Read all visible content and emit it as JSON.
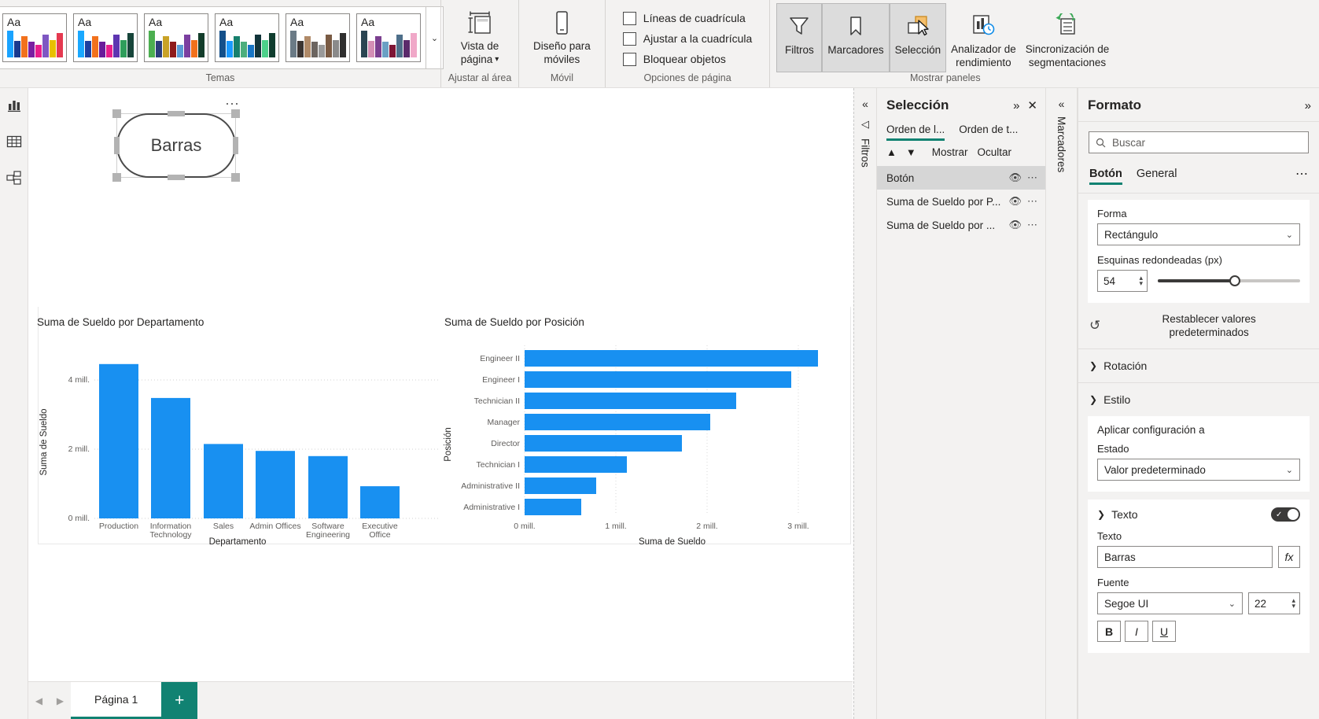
{
  "ribbon": {
    "themes": {
      "group_label": "Temas",
      "card_text": "Aa",
      "cards": [
        {
          "colors": [
            "#1aa3ff",
            "#1a3a8f",
            "#f2711c",
            "#7b1fa2",
            "#e91e8c",
            "#7e57c2",
            "#e8c000",
            "#e53950"
          ]
        },
        {
          "colors": [
            "#19a8ff",
            "#1d3fa0",
            "#f2711c",
            "#6a1b9a",
            "#e91e8c",
            "#5e35b1",
            "#2e9e5b",
            "#17453a"
          ]
        },
        {
          "colors": [
            "#4caf50",
            "#2c3e7a",
            "#c9a227",
            "#8e1b1b",
            "#5b9bd5",
            "#7b3fa0",
            "#f2711c",
            "#133d2b"
          ]
        },
        {
          "colors": [
            "#14508a",
            "#1a9aff",
            "#17806d",
            "#4cae7d",
            "#1775c4",
            "#12343a",
            "#4cd18a",
            "#0f3d2e"
          ]
        },
        {
          "colors": [
            "#6b7b86",
            "#3c3532",
            "#b08a68",
            "#6c6560",
            "#9a9a9a",
            "#7a5b44",
            "#8a8a8a",
            "#2f2f2f"
          ]
        },
        {
          "colors": [
            "#2a4552",
            "#d48fb5",
            "#7b3f8f",
            "#6aa0c4",
            "#7e1535",
            "#4e6f8a",
            "#5b2a6b",
            "#f0a8c8"
          ]
        }
      ],
      "chevron_icon": "chevron-down-icon"
    },
    "fit": {
      "group_label": "Ajustar al área",
      "button_line1": "Vista de",
      "button_line2": "página",
      "icon": "page-view-icon"
    },
    "mobile": {
      "group_label": "Móvil",
      "button_line1": "Diseño para",
      "button_line2": "móviles",
      "icon": "mobile-layout-icon"
    },
    "page_options": {
      "group_label": "Opciones de página",
      "checkboxes": [
        {
          "label": "Líneas de cuadrícula",
          "checked": false
        },
        {
          "label": "Ajustar a la cuadrícula",
          "checked": false
        },
        {
          "label": "Bloquear objetos",
          "checked": false
        }
      ]
    },
    "show_panels": {
      "group_label": "Mostrar paneles",
      "buttons": [
        {
          "label": "Filtros",
          "icon": "funnel-icon",
          "active": true
        },
        {
          "label": "Marcadores",
          "icon": "bookmark-icon",
          "active": true
        },
        {
          "label": "Selección",
          "icon": "selection-icon",
          "active": true
        },
        {
          "label_line1": "Analizador de",
          "label_line2": "rendimiento",
          "icon": "performance-analyzer-icon",
          "active": false
        },
        {
          "label_line1": "Sincronización de",
          "label_line2": "segmentaciones",
          "icon": "sync-slicers-icon",
          "active": false
        }
      ]
    }
  },
  "rail": {
    "items": [
      {
        "name": "report-view",
        "icon": "bar-chart-icon"
      },
      {
        "name": "data-view",
        "icon": "table-icon"
      },
      {
        "name": "model-view",
        "icon": "model-icon"
      }
    ]
  },
  "canvas": {
    "shape_button": {
      "text": "Barras",
      "more_icon": "more-options-icon"
    }
  },
  "chart_data": [
    {
      "type": "bar",
      "title": "Suma de Sueldo por Departamento",
      "xlabel": "Departamento",
      "ylabel": "Suma de Sueldo",
      "categories": [
        "Production",
        "Information Technology",
        "Sales",
        "Admin Offices",
        "Software Engineering",
        "Executive Office"
      ],
      "category_lines": [
        [
          "Production"
        ],
        [
          "Information",
          "Technology"
        ],
        [
          "Sales"
        ],
        [
          "Admin Offices"
        ],
        [
          "Software",
          "Engineering"
        ],
        [
          "Executive",
          "Office"
        ]
      ],
      "values": [
        4.46,
        3.48,
        2.15,
        1.95,
        1.8,
        0.93
      ],
      "unit": "mill.",
      "ylim": [
        0,
        5.0
      ],
      "yticks": [
        0,
        2,
        4
      ],
      "ytick_labels": [
        "0 mill.",
        "2 mill.",
        "4 mill."
      ],
      "grid": true,
      "bar_color": "#1890f1",
      "legend": "none"
    },
    {
      "type": "bar",
      "orientation": "horizontal",
      "title": "Suma de Sueldo por Posición",
      "xlabel": "Suma de Sueldo",
      "ylabel": "Posición",
      "categories": [
        "Engineer II",
        "Engineer I",
        "Technician II",
        "Manager",
        "Director",
        "Technician I",
        "Administrative II",
        "Administrative I"
      ],
      "values": [
        3.22,
        2.92,
        2.32,
        2.03,
        1.72,
        1.12,
        0.78,
        0.62
      ],
      "unit": "mill.",
      "xlim": [
        0,
        3.55
      ],
      "xticks": [
        0,
        1,
        2,
        3
      ],
      "xtick_labels": [
        "0 mill.",
        "1 mill.",
        "2 mill.",
        "3 mill."
      ],
      "grid": true,
      "bar_color": "#1890f1",
      "legend": "none"
    }
  ],
  "selection_panel": {
    "collapse_icon": "chevron-double-left-icon",
    "filters_tab_label": "Filtros",
    "filters_tab_icon": "filter-icon",
    "title": "Selección",
    "expand_icon": "chevron-double-right-icon",
    "close_icon": "close-icon",
    "tabs": [
      {
        "label": "Orden de l...",
        "active": true
      },
      {
        "label": "Orden de t...",
        "active": false
      }
    ],
    "tools": {
      "up_icon": "arrow-up-icon",
      "down_icon": "arrow-down-icon",
      "show_label": "Mostrar",
      "hide_label": "Ocultar"
    },
    "items": [
      {
        "label": "Botón",
        "active": true,
        "eye_icon": "eye-icon",
        "more_icon": "more-options-icon"
      },
      {
        "label": "Suma de Sueldo por P...",
        "active": false,
        "eye_icon": "eye-icon",
        "more_icon": "more-options-icon"
      },
      {
        "label": "Suma de Sueldo por ...",
        "active": false,
        "eye_icon": "eye-icon",
        "more_icon": "more-options-icon"
      }
    ]
  },
  "bookmarks_rail": {
    "collapse_icon": "chevron-double-left-icon",
    "label": "Marcadores"
  },
  "format_panel": {
    "title": "Formato",
    "expand_icon": "chevron-double-right-icon",
    "search": {
      "placeholder": "Buscar",
      "value": "",
      "icon": "search-icon"
    },
    "tabs": [
      {
        "label": "Botón",
        "active": true
      },
      {
        "label": "General",
        "active": false
      }
    ],
    "more_icon": "more-options-icon",
    "shape": {
      "label": "Forma",
      "value": "Rectángulo",
      "chevron_icon": "chevron-down-icon",
      "corners_label": "Esquinas redondeadas (px)",
      "corners_value": "54",
      "slider_percent": 54
    },
    "reset": {
      "label_line1": "Restablecer valores",
      "label_line2": "predeterminados",
      "icon": "reset-icon"
    },
    "rotation": {
      "label": "Rotación",
      "icon": "chevron-right-icon",
      "expanded": false
    },
    "style": {
      "label": "Estilo",
      "icon": "chevron-down-icon",
      "expanded": true
    },
    "apply_settings": {
      "label": "Aplicar configuración a",
      "state_label": "Estado",
      "state_value": "Valor predeterminado",
      "chevron_icon": "chevron-down-icon"
    },
    "text_section": {
      "label": "Texto",
      "icon": "chevron-down-icon",
      "toggle_on": true,
      "text_label": "Texto",
      "text_value": "Barras",
      "fx_label": "fx",
      "font_label": "Fuente",
      "font_family": "Segoe UI",
      "font_size": "22",
      "bold": "B",
      "italic": "I",
      "underline": "U"
    }
  },
  "page_bar": {
    "prev_icon": "chevron-left-icon",
    "next_icon": "chevron-right-icon",
    "tabs": [
      {
        "label": "Página 1",
        "active": true
      }
    ],
    "add_label": "+"
  },
  "colors": {
    "accent": "#118272",
    "bar": "#1890f1",
    "ribbon_bg": "#f3f2f1"
  }
}
